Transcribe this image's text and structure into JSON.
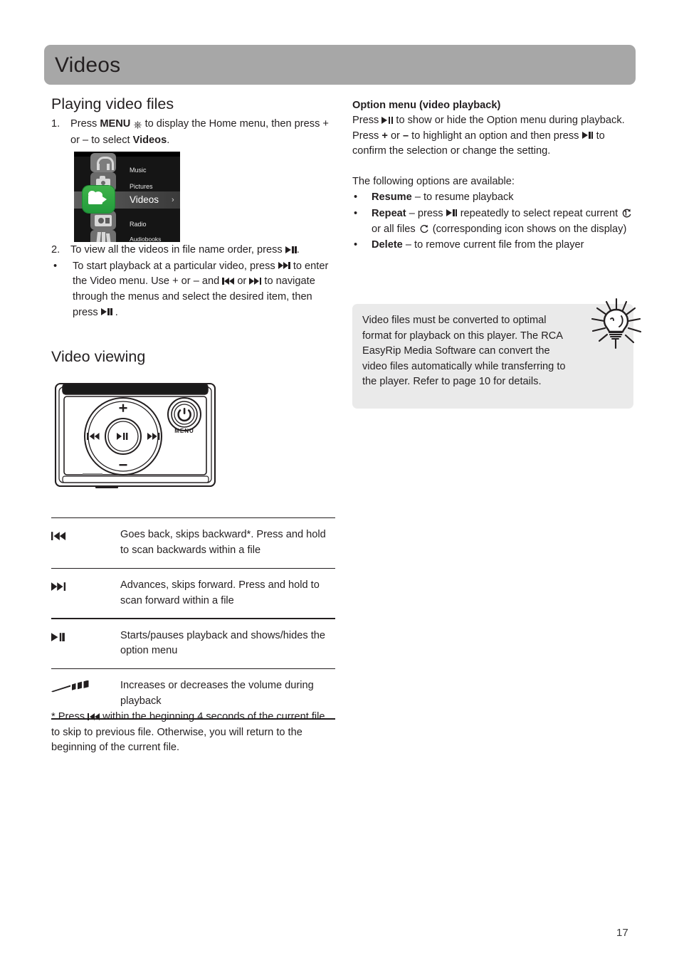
{
  "header": {
    "title": "Videos"
  },
  "page": {
    "number": "17"
  },
  "left": {
    "section_title": "Playing video files",
    "step1": {
      "marker": "1.",
      "part1": "Press ",
      "menu_bold": "MENU",
      "part2": " to display the Home menu, then press + or – to select ",
      "videos_bold": "Videos",
      "part3": "."
    },
    "step2": {
      "marker": "2.",
      "part1": "To view all the videos in file name order, press ",
      "part2": "."
    },
    "bullet1": {
      "marker": "•",
      "part1": "To start playback at a particular video, press ",
      "part2": " to enter the Video menu. Use + or – and ",
      "part3": " or ",
      "part4": " to navigate through the menus and select the desired item, then press ",
      "part5": " ."
    },
    "menu_screenshot": {
      "items": [
        "Music",
        "Pictures",
        "Videos",
        "Radio",
        "Audiobooks"
      ],
      "selected": "Videos",
      "chevron": "›",
      "accent_color": "#2fa844"
    },
    "video_viewing_title": "Video viewing",
    "device": {
      "plus_label": "+",
      "minus_label": "–",
      "menu_label": "MENU"
    },
    "keytable": [
      {
        "icon": "skip-backward-icon",
        "text": "Goes back, skips backward*. Press and hold to scan backwards within a file"
      },
      {
        "icon": "skip-forward-icon",
        "text": "Advances, skips forward. Press and hold to scan forward within a file"
      },
      {
        "icon": "play-pause-icon",
        "text": "Starts/pauses playback and shows/hides the option menu"
      },
      {
        "icon": "volume-icon",
        "text": "Increases or decreases the volume during playback"
      }
    ],
    "footnote": {
      "part1": "* Press ",
      "part2": " within the beginning 4 seconds of the current file to skip to previous file. Otherwise, you will return to the beginning of the current file."
    }
  },
  "right": {
    "option_menu_title": "Option menu (video playback)",
    "option_intro": {
      "part1": "Press ",
      "part2": " to show or hide the Option menu during playback. Press ",
      "plus": "+",
      "or": " or ",
      "minus": "–",
      "part3": " to highlight an option and then press ",
      "part4": " to confirm the selection or change the setting."
    },
    "options_lead": "The following options are available:",
    "options": [
      {
        "marker": "•",
        "name": "Resume",
        "text": " – to resume playback"
      },
      {
        "marker": "•",
        "name": "Repeat",
        "text_a": " – press ",
        "text_b": " repeatedly to select repeat current ",
        "text_c": " or all files ",
        "text_d": " (corresponding icon shows on the display)"
      },
      {
        "marker": "•",
        "name": "Delete",
        "text": " – to remove current file from the player"
      }
    ],
    "note": {
      "text": "Video files must be converted to optimal format for playback on this player. The RCA EasyRip Media Software can convert the video files automatically while transferring to the player. Refer to page 10 for details.",
      "icon": "lightbulb-icon",
      "background": "#eaeaea"
    }
  }
}
